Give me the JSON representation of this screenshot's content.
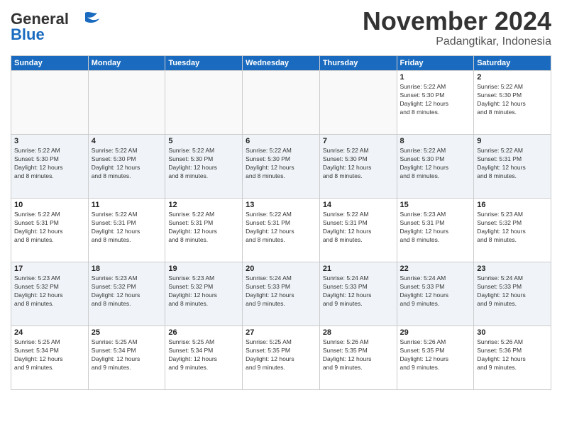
{
  "header": {
    "logo_line1": "General",
    "logo_line2": "Blue",
    "month": "November 2024",
    "location": "Padangtikar, Indonesia"
  },
  "weekdays": [
    "Sunday",
    "Monday",
    "Tuesday",
    "Wednesday",
    "Thursday",
    "Friday",
    "Saturday"
  ],
  "rows": [
    [
      {
        "day": "",
        "info": ""
      },
      {
        "day": "",
        "info": ""
      },
      {
        "day": "",
        "info": ""
      },
      {
        "day": "",
        "info": ""
      },
      {
        "day": "",
        "info": ""
      },
      {
        "day": "1",
        "info": "Sunrise: 5:22 AM\nSunset: 5:30 PM\nDaylight: 12 hours\nand 8 minutes."
      },
      {
        "day": "2",
        "info": "Sunrise: 5:22 AM\nSunset: 5:30 PM\nDaylight: 12 hours\nand 8 minutes."
      }
    ],
    [
      {
        "day": "3",
        "info": "Sunrise: 5:22 AM\nSunset: 5:30 PM\nDaylight: 12 hours\nand 8 minutes."
      },
      {
        "day": "4",
        "info": "Sunrise: 5:22 AM\nSunset: 5:30 PM\nDaylight: 12 hours\nand 8 minutes."
      },
      {
        "day": "5",
        "info": "Sunrise: 5:22 AM\nSunset: 5:30 PM\nDaylight: 12 hours\nand 8 minutes."
      },
      {
        "day": "6",
        "info": "Sunrise: 5:22 AM\nSunset: 5:30 PM\nDaylight: 12 hours\nand 8 minutes."
      },
      {
        "day": "7",
        "info": "Sunrise: 5:22 AM\nSunset: 5:30 PM\nDaylight: 12 hours\nand 8 minutes."
      },
      {
        "day": "8",
        "info": "Sunrise: 5:22 AM\nSunset: 5:30 PM\nDaylight: 12 hours\nand 8 minutes."
      },
      {
        "day": "9",
        "info": "Sunrise: 5:22 AM\nSunset: 5:31 PM\nDaylight: 12 hours\nand 8 minutes."
      }
    ],
    [
      {
        "day": "10",
        "info": "Sunrise: 5:22 AM\nSunset: 5:31 PM\nDaylight: 12 hours\nand 8 minutes."
      },
      {
        "day": "11",
        "info": "Sunrise: 5:22 AM\nSunset: 5:31 PM\nDaylight: 12 hours\nand 8 minutes."
      },
      {
        "day": "12",
        "info": "Sunrise: 5:22 AM\nSunset: 5:31 PM\nDaylight: 12 hours\nand 8 minutes."
      },
      {
        "day": "13",
        "info": "Sunrise: 5:22 AM\nSunset: 5:31 PM\nDaylight: 12 hours\nand 8 minutes."
      },
      {
        "day": "14",
        "info": "Sunrise: 5:22 AM\nSunset: 5:31 PM\nDaylight: 12 hours\nand 8 minutes."
      },
      {
        "day": "15",
        "info": "Sunrise: 5:23 AM\nSunset: 5:31 PM\nDaylight: 12 hours\nand 8 minutes."
      },
      {
        "day": "16",
        "info": "Sunrise: 5:23 AM\nSunset: 5:32 PM\nDaylight: 12 hours\nand 8 minutes."
      }
    ],
    [
      {
        "day": "17",
        "info": "Sunrise: 5:23 AM\nSunset: 5:32 PM\nDaylight: 12 hours\nand 8 minutes."
      },
      {
        "day": "18",
        "info": "Sunrise: 5:23 AM\nSunset: 5:32 PM\nDaylight: 12 hours\nand 8 minutes."
      },
      {
        "day": "19",
        "info": "Sunrise: 5:23 AM\nSunset: 5:32 PM\nDaylight: 12 hours\nand 8 minutes."
      },
      {
        "day": "20",
        "info": "Sunrise: 5:24 AM\nSunset: 5:33 PM\nDaylight: 12 hours\nand 9 minutes."
      },
      {
        "day": "21",
        "info": "Sunrise: 5:24 AM\nSunset: 5:33 PM\nDaylight: 12 hours\nand 9 minutes."
      },
      {
        "day": "22",
        "info": "Sunrise: 5:24 AM\nSunset: 5:33 PM\nDaylight: 12 hours\nand 9 minutes."
      },
      {
        "day": "23",
        "info": "Sunrise: 5:24 AM\nSunset: 5:33 PM\nDaylight: 12 hours\nand 9 minutes."
      }
    ],
    [
      {
        "day": "24",
        "info": "Sunrise: 5:25 AM\nSunset: 5:34 PM\nDaylight: 12 hours\nand 9 minutes."
      },
      {
        "day": "25",
        "info": "Sunrise: 5:25 AM\nSunset: 5:34 PM\nDaylight: 12 hours\nand 9 minutes."
      },
      {
        "day": "26",
        "info": "Sunrise: 5:25 AM\nSunset: 5:34 PM\nDaylight: 12 hours\nand 9 minutes."
      },
      {
        "day": "27",
        "info": "Sunrise: 5:25 AM\nSunset: 5:35 PM\nDaylight: 12 hours\nand 9 minutes."
      },
      {
        "day": "28",
        "info": "Sunrise: 5:26 AM\nSunset: 5:35 PM\nDaylight: 12 hours\nand 9 minutes."
      },
      {
        "day": "29",
        "info": "Sunrise: 5:26 AM\nSunset: 5:35 PM\nDaylight: 12 hours\nand 9 minutes."
      },
      {
        "day": "30",
        "info": "Sunrise: 5:26 AM\nSunset: 5:36 PM\nDaylight: 12 hours\nand 9 minutes."
      }
    ]
  ]
}
